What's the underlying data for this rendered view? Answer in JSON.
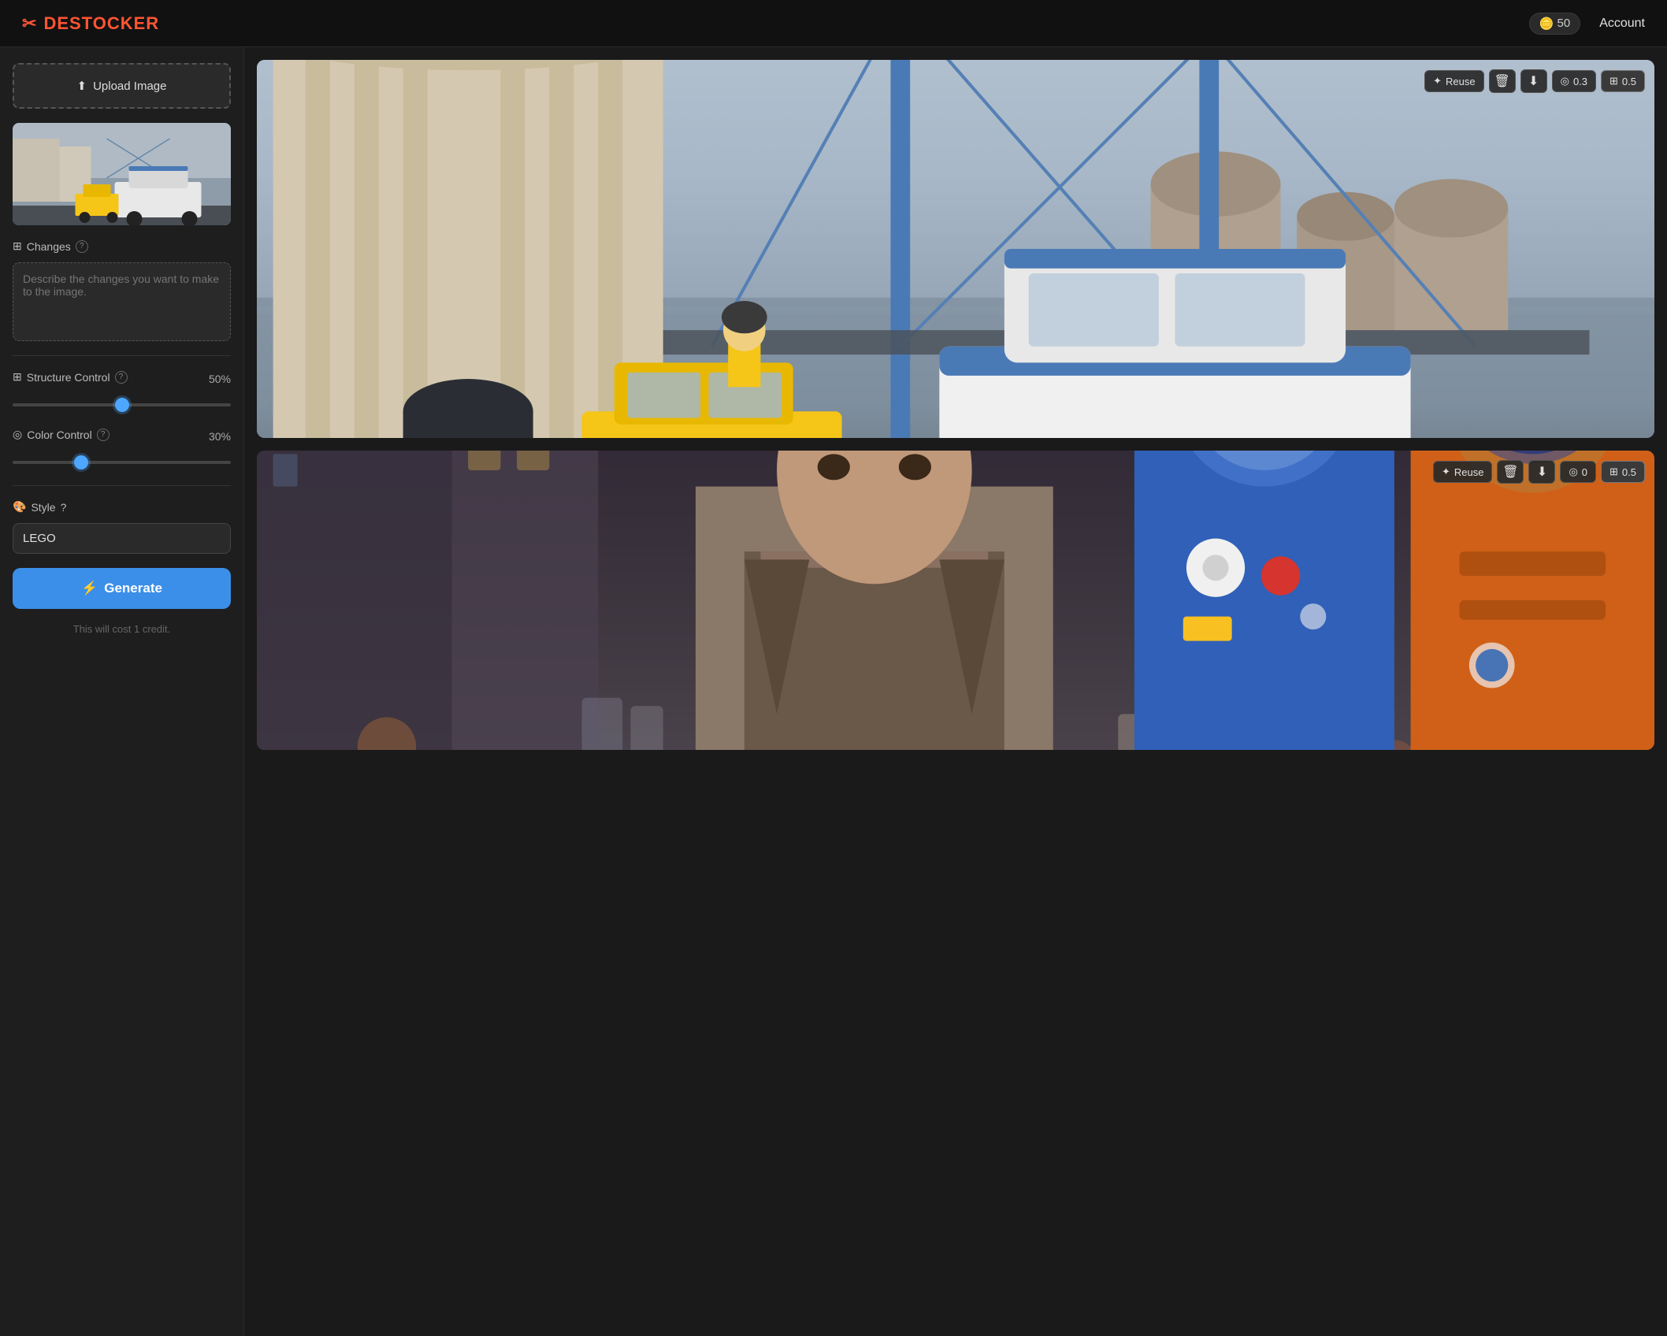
{
  "app": {
    "name": "DESTOCKER",
    "logo_icon": "✂"
  },
  "header": {
    "credits_icon": "🪙",
    "credits_count": "50",
    "account_label": "Account"
  },
  "sidebar": {
    "upload_label": "Upload Image",
    "upload_icon": "⬆",
    "changes_label": "Changes",
    "changes_placeholder": "Describe the changes you want to make to the image.",
    "structure_control_label": "Structure Control",
    "structure_control_value": "50%",
    "structure_control_percent": 50,
    "color_control_label": "Color Control",
    "color_control_value": "30%",
    "color_control_percent": 30,
    "style_label": "Style",
    "style_icon": "🎨",
    "style_value": "LEGO",
    "generate_label": "Generate",
    "generate_icon": "⚡",
    "cost_text": "This will cost 1 credit.",
    "help_text": "?"
  },
  "results": [
    {
      "id": "result-1",
      "reuse_label": "Reuse",
      "reuse_icon": "✦",
      "delete_icon": "🗑",
      "download_icon": "⬇",
      "similarity_value": "0.3",
      "grid_value": "0.5"
    },
    {
      "id": "result-2",
      "reuse_label": "Reuse",
      "reuse_icon": "✦",
      "delete_icon": "🗑",
      "download_icon": "⬇",
      "similarity_value": "0",
      "grid_value": "0.5"
    }
  ]
}
